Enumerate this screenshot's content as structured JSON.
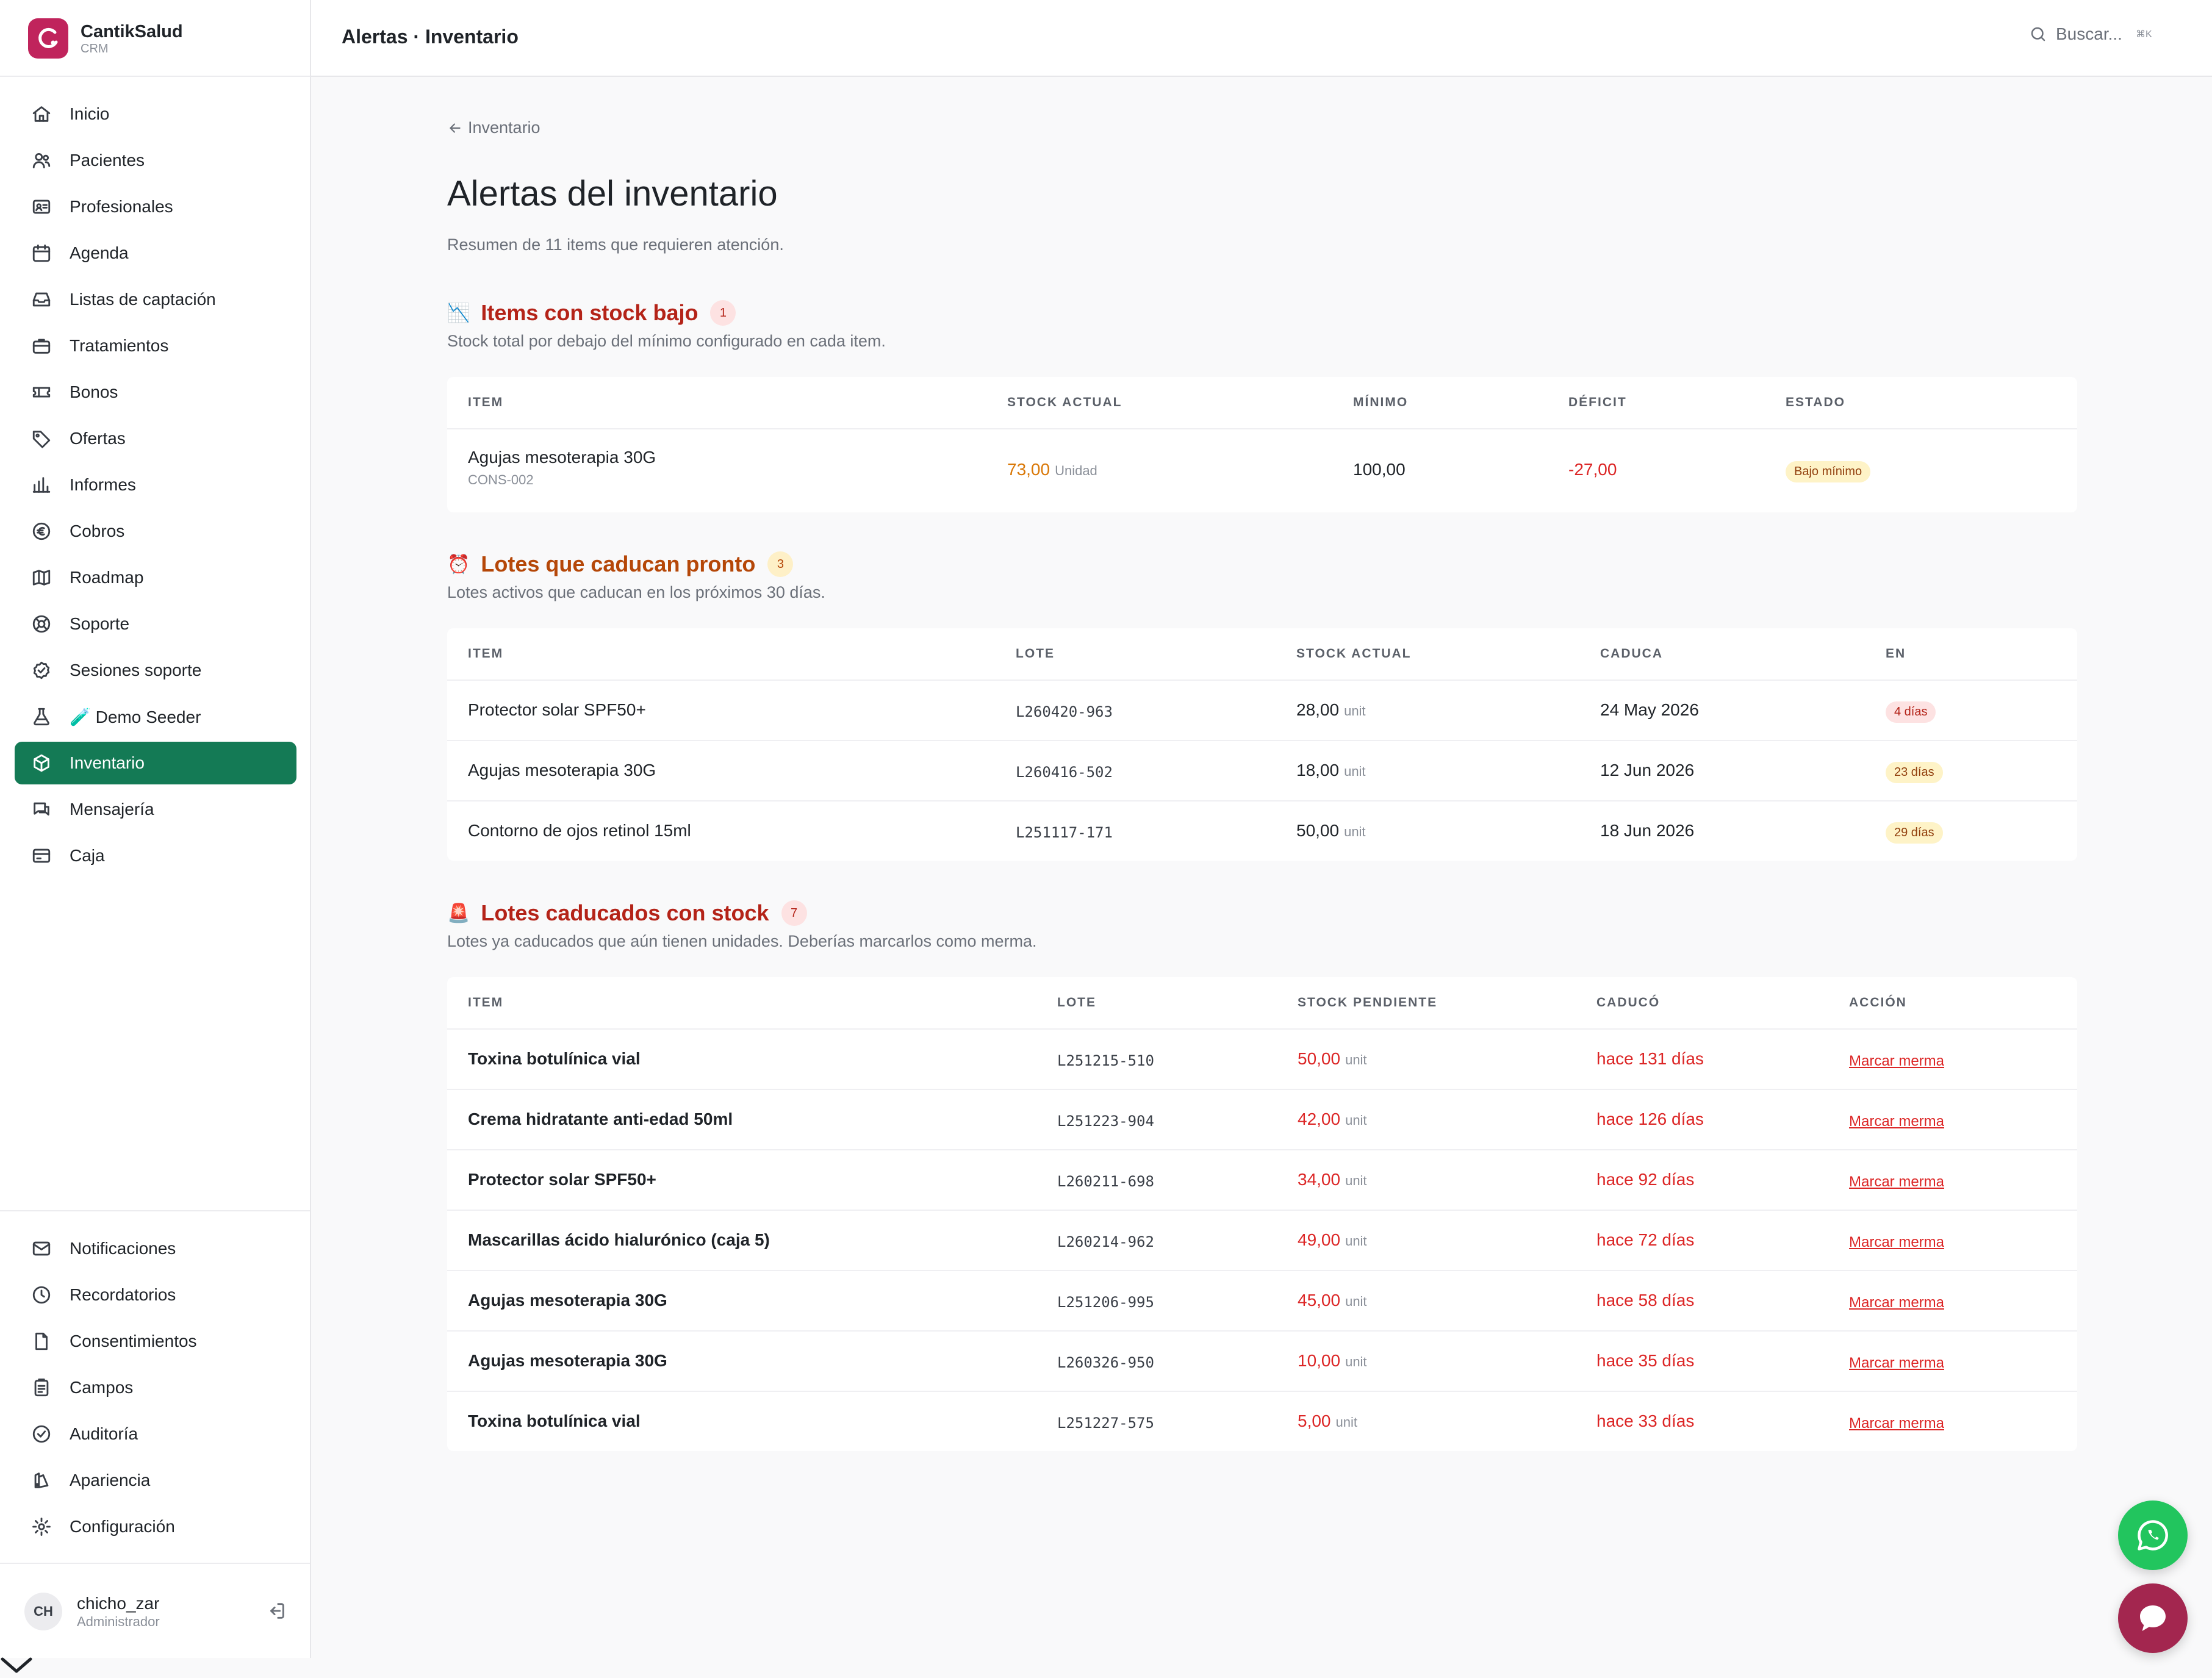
{
  "brand": {
    "name": "CantikSalud",
    "sub": "CRM"
  },
  "nav_primary": [
    {
      "label": "Inicio",
      "icon": "home-icon"
    },
    {
      "label": "Pacientes",
      "icon": "users-icon"
    },
    {
      "label": "Profesionales",
      "icon": "id-card-icon"
    },
    {
      "label": "Agenda",
      "icon": "calendar-icon"
    },
    {
      "label": "Listas de captación",
      "icon": "inbox-icon"
    },
    {
      "label": "Tratamientos",
      "icon": "briefcase-icon"
    },
    {
      "label": "Bonos",
      "icon": "ticket-icon"
    },
    {
      "label": "Ofertas",
      "icon": "tag-icon"
    },
    {
      "label": "Informes",
      "icon": "bar-chart-icon"
    },
    {
      "label": "Cobros",
      "icon": "euro-icon"
    },
    {
      "label": "Roadmap",
      "icon": "map-icon"
    },
    {
      "label": "Soporte",
      "icon": "lifebuoy-icon"
    },
    {
      "label": "Sesiones soporte",
      "icon": "check-badge-icon"
    },
    {
      "label": "🧪 Demo Seeder",
      "icon": "flask-icon"
    },
    {
      "label": "Inventario",
      "icon": "box-icon",
      "active": true
    },
    {
      "label": "Mensajería",
      "icon": "messages-icon"
    },
    {
      "label": "Caja",
      "icon": "credit-card-icon"
    }
  ],
  "nav_secondary": [
    {
      "label": "Notificaciones",
      "icon": "mail-icon"
    },
    {
      "label": "Recordatorios",
      "icon": "clock-icon"
    },
    {
      "label": "Consentimientos",
      "icon": "file-icon"
    },
    {
      "label": "Campos",
      "icon": "clipboard-icon"
    },
    {
      "label": "Auditoría",
      "icon": "shield-check-icon"
    },
    {
      "label": "Apariencia",
      "icon": "palette-icon"
    },
    {
      "label": "Configuración",
      "icon": "gear-icon"
    }
  ],
  "user": {
    "initials": "CH",
    "name": "chicho_zar",
    "role": "Administrador"
  },
  "topbar": {
    "title": "Alertas · Inventario",
    "search_placeholder": "Buscar...",
    "shortcut": "⌘K"
  },
  "page": {
    "back_label": "Inventario",
    "title": "Alertas del inventario",
    "subtitle": "Resumen de 11 items que requieren atención."
  },
  "low_stock": {
    "emoji": "📉",
    "title": "Items con stock bajo",
    "count": "1",
    "description": "Stock total por debajo del mínimo configurado en cada item.",
    "headers": [
      "ITEM",
      "STOCK ACTUAL",
      "MÍNIMO",
      "DÉFICIT",
      "ESTADO"
    ],
    "rows": [
      {
        "item": "Agujas mesoterapia 30G",
        "code": "CONS-002",
        "stock": "73,00",
        "unit": "Unidad",
        "minimum": "100,00",
        "deficit": "-27,00",
        "status": "Bajo mínimo"
      }
    ]
  },
  "expiring": {
    "emoji": "⏰",
    "title": "Lotes que caducan pronto",
    "count": "3",
    "description": "Lotes activos que caducan en los próximos 30 días.",
    "headers": [
      "ITEM",
      "LOTE",
      "STOCK ACTUAL",
      "CADUCA",
      "EN"
    ],
    "rows": [
      {
        "item": "Protector solar SPF50+",
        "lot": "L260420-963",
        "stock": "28,00",
        "unit": "unit",
        "expires": "24 May 2026",
        "in": "4 días",
        "level": "urgent"
      },
      {
        "item": "Agujas mesoterapia 30G",
        "lot": "L260416-502",
        "stock": "18,00",
        "unit": "unit",
        "expires": "12 Jun 2026",
        "in": "23 días",
        "level": "warn"
      },
      {
        "item": "Contorno de ojos retinol 15ml",
        "lot": "L251117-171",
        "stock": "50,00",
        "unit": "unit",
        "expires": "18 Jun 2026",
        "in": "29 días",
        "level": "warn"
      }
    ]
  },
  "expired": {
    "emoji": "🚨",
    "title": "Lotes caducados con stock",
    "count": "7",
    "description": "Lotes ya caducados que aún tienen unidades. Deberías marcarlos como merma.",
    "headers": [
      "ITEM",
      "LOTE",
      "STOCK PENDIENTE",
      "CADUCÓ",
      "ACCIÓN"
    ],
    "action_label": "Marcar merma",
    "rows": [
      {
        "item": "Toxina botulínica vial",
        "lot": "L251215-510",
        "stock": "50,00",
        "unit": "unit",
        "expired": "hace 131 días"
      },
      {
        "item": "Crema hidratante anti-edad 50ml",
        "lot": "L251223-904",
        "stock": "42,00",
        "unit": "unit",
        "expired": "hace 126 días"
      },
      {
        "item": "Protector solar SPF50+",
        "lot": "L260211-698",
        "stock": "34,00",
        "unit": "unit",
        "expired": "hace 92 días"
      },
      {
        "item": "Mascarillas ácido hialurónico (caja 5)",
        "lot": "L260214-962",
        "stock": "49,00",
        "unit": "unit",
        "expired": "hace 72 días"
      },
      {
        "item": "Agujas mesoterapia 30G",
        "lot": "L251206-995",
        "stock": "45,00",
        "unit": "unit",
        "expired": "hace 58 días"
      },
      {
        "item": "Agujas mesoterapia 30G",
        "lot": "L260326-950",
        "stock": "10,00",
        "unit": "unit",
        "expired": "hace 35 días"
      },
      {
        "item": "Toxina botulínica vial",
        "lot": "L251227-575",
        "stock": "5,00",
        "unit": "unit",
        "expired": "hace 33 días"
      }
    ]
  },
  "colors": {
    "accent": "#147a55",
    "brand": "#c0245c",
    "danger": "#dc2626",
    "danger_title": "#b42318",
    "warning_title": "#b54708",
    "stock_warning": "#d97706",
    "whatsapp": "#22c55e",
    "chat": "#a3264f"
  }
}
